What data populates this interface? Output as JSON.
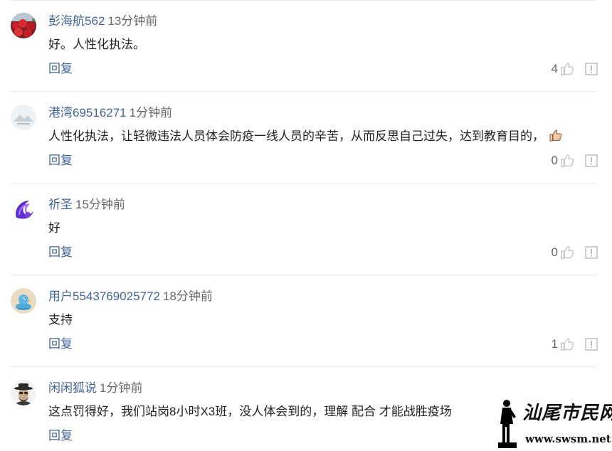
{
  "comments": [
    {
      "username": "彭海航562",
      "time": "13分钟前",
      "content": "好。人性化执法。",
      "reply_label": "回复",
      "likes": "4",
      "avatar": "red-flowers-avatar",
      "has_emoji": false
    },
    {
      "username": "港湾69516271",
      "time": "1分钟前",
      "content": "人性化执法，让轻微违法人员体会防疫一线人员的辛苦，从而反思自己过失，达到教育目的，",
      "reply_label": "回复",
      "likes": "0",
      "avatar": "landscape-avatar",
      "has_emoji": true,
      "emoji": "thumbs-up-emoji"
    },
    {
      "username": "祈圣",
      "time": "15分钟前",
      "content": "好",
      "reply_label": "回复",
      "likes": "0",
      "avatar": "purple-swirl-avatar",
      "has_emoji": false
    },
    {
      "username": "用户5543769025772",
      "time": "18分钟前",
      "content": "支持",
      "reply_label": "回复",
      "likes": "1",
      "avatar": "cartoon-bird-avatar",
      "has_emoji": false
    },
    {
      "username": "闲闲狐说",
      "time": "1分钟前",
      "content": "这点罚得好，我们站岗8小时X3班，没人体会到的，理解 配合 才能战胜疫场",
      "reply_label": "回复",
      "avatar": "man-with-hat-avatar",
      "has_emoji": false
    }
  ],
  "watermark": {
    "name": "汕尾市民网",
    "url": "www.swsm.net"
  },
  "colors": {
    "username": "#406599",
    "text": "#222222",
    "muted": "#666666",
    "divider": "#ececec",
    "icon": "#c8c8c8"
  }
}
